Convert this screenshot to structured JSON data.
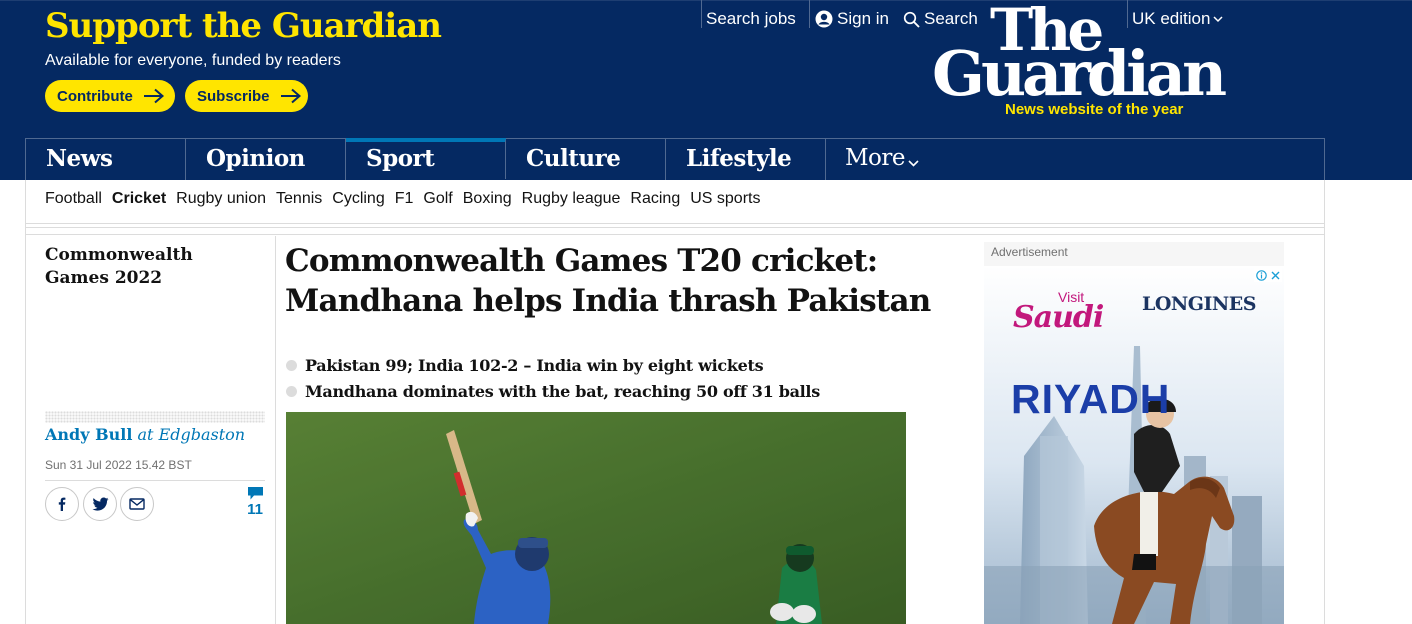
{
  "support": {
    "title": "Support the Guardian",
    "subtitle": "Available for everyone, funded by readers",
    "contribute_label": "Contribute",
    "subscribe_label": "Subscribe"
  },
  "top_links": {
    "jobs": "Search jobs",
    "sign_in": "Sign in",
    "search": "Search",
    "edition": "UK edition"
  },
  "logo": {
    "line1": "The",
    "line2": "Guardian",
    "tagline": "News website of the year"
  },
  "pillars": [
    {
      "label": "News",
      "active": false
    },
    {
      "label": "Opinion",
      "active": false
    },
    {
      "label": "Sport",
      "active": true
    },
    {
      "label": "Culture",
      "active": false
    },
    {
      "label": "Lifestyle",
      "active": false
    },
    {
      "label": "More",
      "active": false
    }
  ],
  "subnav": [
    {
      "label": "Football",
      "active": false
    },
    {
      "label": "Cricket",
      "active": true
    },
    {
      "label": "Rugby union",
      "active": false
    },
    {
      "label": "Tennis",
      "active": false
    },
    {
      "label": "Cycling",
      "active": false
    },
    {
      "label": "F1",
      "active": false
    },
    {
      "label": "Golf",
      "active": false
    },
    {
      "label": "Boxing",
      "active": false
    },
    {
      "label": "Rugby league",
      "active": false
    },
    {
      "label": "Racing",
      "active": false
    },
    {
      "label": "US sports",
      "active": false
    }
  ],
  "article": {
    "series": "Commonwealth Games 2022",
    "headline": "Commonwealth Games T20 cricket: Mandhana helps India thrash Pakistan",
    "standfirst": [
      "Pakistan 99; India 102-2 – India win by eight wickets",
      "Mandhana dominates with the bat, reaching 50 off 31 balls"
    ],
    "author": "Andy Bull",
    "location": "at Edgbaston",
    "date": "Sun 31 Jul 2022 15.42 BST",
    "comment_count": "11"
  },
  "advert": {
    "label": "Advertisement",
    "visit": "Visit",
    "brand": "Saudi",
    "sponsor": "LONGINES",
    "city": "RIYADH"
  },
  "colors": {
    "brand_blue": "#052962",
    "accent_yellow": "#ffe500",
    "sport_blue": "#0077b6"
  },
  "icons": [
    "arrow-right-icon",
    "account-icon",
    "search-icon",
    "chevron-down-icon",
    "facebook-icon",
    "twitter-icon",
    "email-icon",
    "comment-icon",
    "adchoices-icon",
    "close-icon"
  ]
}
